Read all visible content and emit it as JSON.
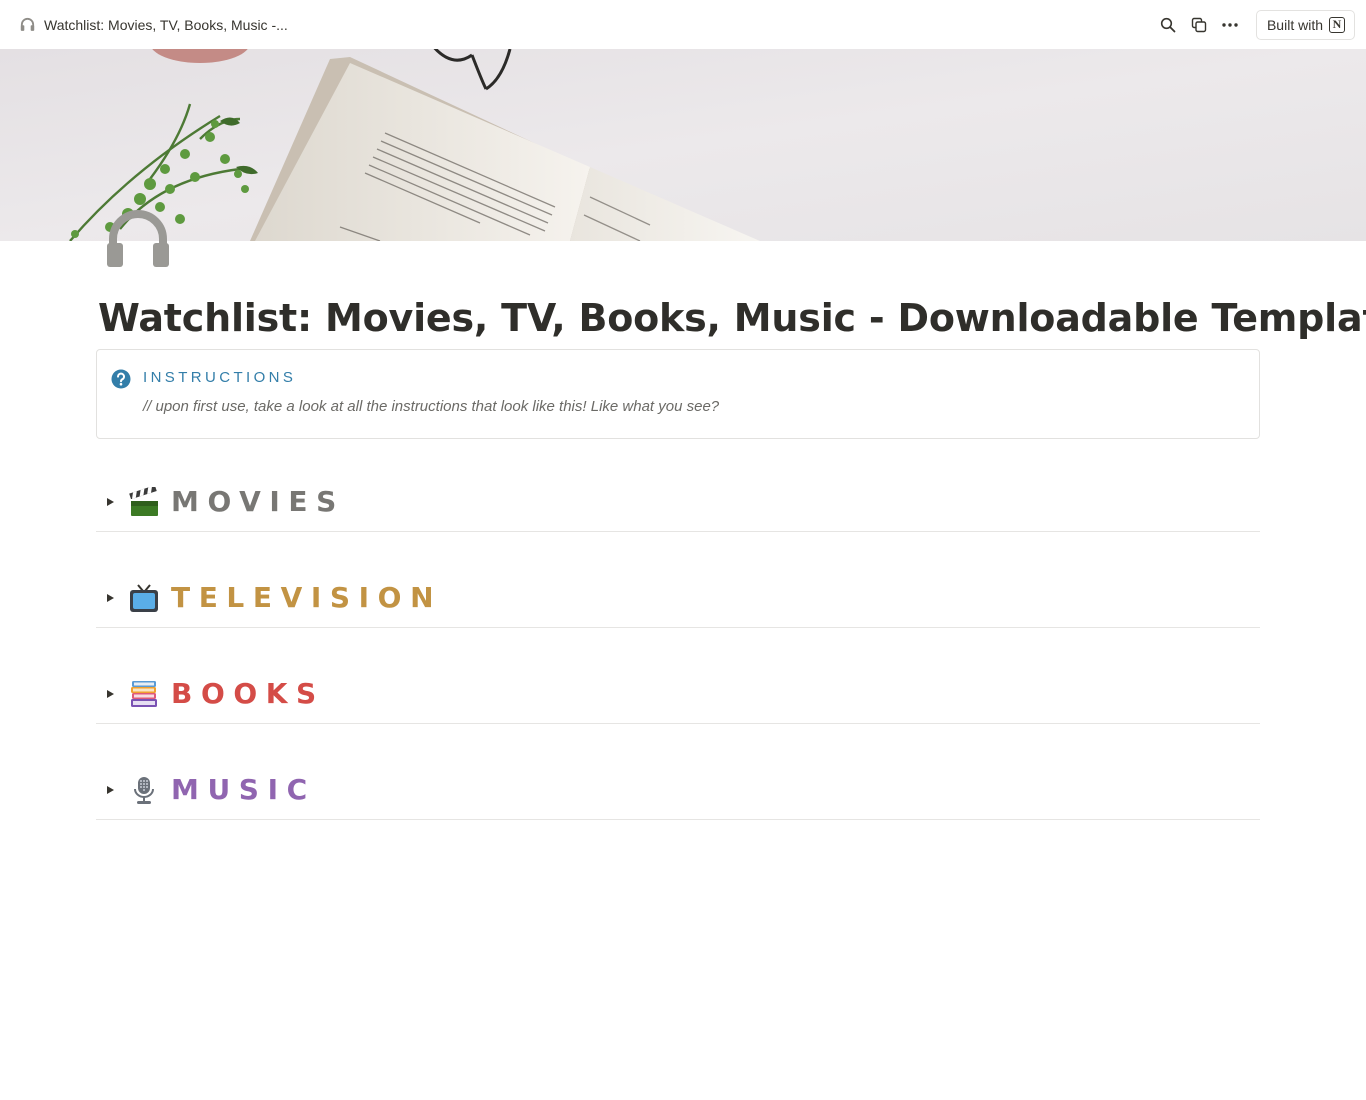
{
  "topbar": {
    "page_title": "Watchlist: Movies, TV, Books, Music -...",
    "page_icon": "headphones-icon",
    "actions": [
      "search-icon",
      "duplicate-icon",
      "more-icon"
    ],
    "built_with_label": "Built with",
    "built_with_logo": "N"
  },
  "page": {
    "icon": "headphones-icon",
    "title": "Watchlist: Movies, TV, Books, Music - Downloadable Template"
  },
  "callout": {
    "icon": "question-circle-icon",
    "title": "INSTRUCTIONS",
    "text": "// upon first use, take a look at all the instructions that look like this! Like what you see?"
  },
  "sections": [
    {
      "label": "MOVIES",
      "emoji": "clapper-board-icon",
      "color": "#787774"
    },
    {
      "label": "TELEVISION",
      "emoji": "television-icon",
      "color": "#c29343"
    },
    {
      "label": "BOOKS",
      "emoji": "books-icon",
      "color": "#d44c47"
    },
    {
      "label": "MUSIC",
      "emoji": "microphone-icon",
      "color": "#9065b0"
    }
  ],
  "colors": {
    "text": "#37352f",
    "callout_accent": "#337ea9",
    "divider": "#e6e5e3"
  }
}
